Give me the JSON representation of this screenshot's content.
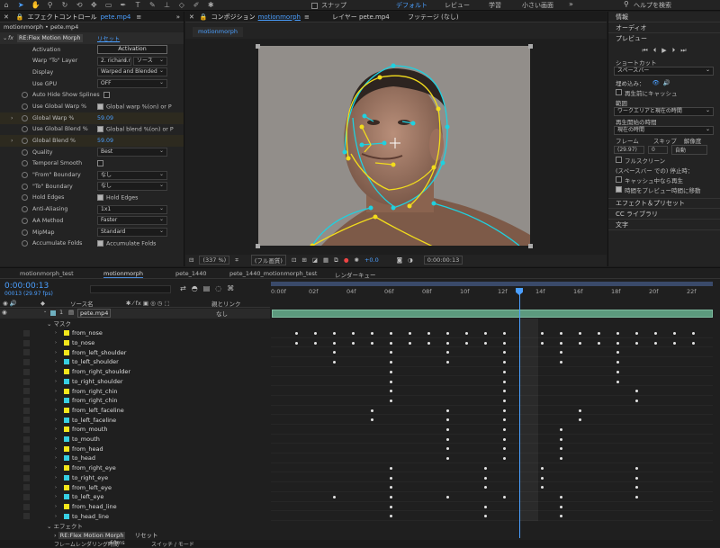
{
  "toolbar": {
    "snap": "スナップ",
    "workspaces": [
      "デフォルト",
      "レビュー",
      "学習",
      "小さい画面"
    ],
    "active_workspace": "デフォルト",
    "help_placeholder": "ヘルプを検索"
  },
  "effect_controls": {
    "tab": "エフェクトコントロール",
    "tab_file": "pete.mp4",
    "breadcrumb": "motionmorph • pete.mp4",
    "fx_name": "RE:Flex Motion Morph",
    "reset": "リセット",
    "rows": [
      {
        "label": "Activation",
        "type": "button",
        "value": "Activation"
      },
      {
        "label": "Warp \"To\" Layer",
        "type": "dropdown2",
        "value": "2. richard.n",
        "value2": "ソース"
      },
      {
        "label": "Display",
        "type": "dropdown",
        "value": "Warped and Blended"
      },
      {
        "label": "Use GPU",
        "type": "dropdown",
        "value": "OFF"
      },
      {
        "label": "Auto Hide Show Splines",
        "type": "check",
        "value": ""
      },
      {
        "label": "Use Global Warp %",
        "type": "checklabel",
        "value": "Global warp %(on) or P"
      },
      {
        "label": "Global Warp %",
        "type": "number",
        "value": "59.09"
      },
      {
        "label": "Use Global Blend %",
        "type": "checklabel",
        "value": "Global blend %(on) or P"
      },
      {
        "label": "Global Blend %",
        "type": "number",
        "value": "59.09"
      },
      {
        "label": "Quality",
        "type": "dropdown",
        "value": "Best"
      },
      {
        "label": "Temporal Smooth",
        "type": "check",
        "value": ""
      },
      {
        "label": "\"From\" Boundary",
        "type": "dropdown",
        "value": "なし"
      },
      {
        "label": "\"To\" Boundary",
        "type": "dropdown",
        "value": "なし"
      },
      {
        "label": "Hold Edges",
        "type": "checklabel",
        "value": "Hold Edges"
      },
      {
        "label": "Anti-Aliasing",
        "type": "dropdown",
        "value": "1x1"
      },
      {
        "label": "AA Method",
        "type": "dropdown",
        "value": "Faster"
      },
      {
        "label": "MipMap",
        "type": "dropdown",
        "value": "Standard"
      },
      {
        "label": "Accumulate Folds",
        "type": "checklabel",
        "value": "Accumulate Folds"
      }
    ]
  },
  "composition": {
    "tab": "コンポジション",
    "comp_name": "motionmorph",
    "layer_tab": "レイヤー pete.mp4",
    "footage_tab": "フッテージ (なし)",
    "sub_tab": "motionmorph",
    "zoom": "(337 %)",
    "resolution": "(フル画質)",
    "exposure": "+0.0",
    "timecode": "0:00:00:13"
  },
  "right_panel": {
    "info": "情報",
    "audio": "オーディオ",
    "preview": "プレビュー",
    "shortcut_label": "ショートカット",
    "shortcut_value": "スペースバー",
    "include_label": "埋め込み：",
    "cache_before": "再生前にキャッシュ",
    "range_label": "範囲",
    "range_value": "ワークエリアと現在の時間",
    "start_label": "再生開始の時間",
    "start_value": "現在の時間",
    "frame_label": "フレーム",
    "skip_label": "スキップ",
    "res_label": "解像度",
    "fps_value": "(29.97)",
    "skip_value": "0",
    "res_value": "自動",
    "fullscreen": "フルスクリーン",
    "stop_label": "(スペースバー での) 停止時：",
    "cache_while": "キャッシュ中なら再生",
    "move_time": "時間をプレビュー時間に移動",
    "effects_presets": "エフェクト＆プリセット",
    "cc_library": "CC ライブラリ",
    "text": "文字"
  },
  "timeline": {
    "tabs": [
      "motionmorph_test",
      "motionmorph",
      "pete_1440",
      "pete_1440_motionmorph_test",
      "レンダーキュー"
    ],
    "active_tab": "motionmorph",
    "timecode": "0:00:00:13",
    "frame_info": "00013 (29.97 fps)",
    "source_name_header": "ソース名",
    "parent_header": "親とリンク",
    "layer_num": "1",
    "layer_name": "pete.mp4",
    "parent_value": "なし",
    "mask_group": "マスク",
    "effect_group": "エフェクト",
    "effect_item": "RE:Flex Motion Morph",
    "bottom_label": "フレームレンダリング時間",
    "bottom_value": "60ms",
    "switch_mode": "スイッチ / モード",
    "ruler": [
      "0:00f",
      "02f",
      "04f",
      "06f",
      "08f",
      "10f",
      "12f",
      "14f",
      "16f",
      "18f",
      "20f",
      "22f"
    ],
    "masks": [
      {
        "name": "from_nose",
        "color": "#f3e61b"
      },
      {
        "name": "to_nose",
        "color": "#f3e61b"
      },
      {
        "name": "from_left_shoulder",
        "color": "#f3e61b"
      },
      {
        "name": "to_left_shoulder",
        "color": "#37cfe3"
      },
      {
        "name": "from_right_shoulder",
        "color": "#f3e61b"
      },
      {
        "name": "to_right_shoulder",
        "color": "#37cfe3"
      },
      {
        "name": "from_right_chin",
        "color": "#f3e61b"
      },
      {
        "name": "from_right_chin",
        "color": "#37cfe3"
      },
      {
        "name": "from_left_faceline",
        "color": "#f3e61b"
      },
      {
        "name": "to_left_faceline",
        "color": "#37cfe3"
      },
      {
        "name": "from_mouth",
        "color": "#f3e61b"
      },
      {
        "name": "to_mouth",
        "color": "#37cfe3"
      },
      {
        "name": "from_head",
        "color": "#f3e61b"
      },
      {
        "name": "to_head",
        "color": "#37cfe3"
      },
      {
        "name": "from_right_eye",
        "color": "#f3e61b"
      },
      {
        "name": "to_right_eye",
        "color": "#37cfe3"
      },
      {
        "name": "from_left_eye",
        "color": "#f3e61b"
      },
      {
        "name": "to_left_eye",
        "color": "#37cfe3"
      },
      {
        "name": "from_head_line",
        "color": "#f3e61b"
      },
      {
        "name": "to_head_line",
        "color": "#37cfe3"
      }
    ]
  }
}
